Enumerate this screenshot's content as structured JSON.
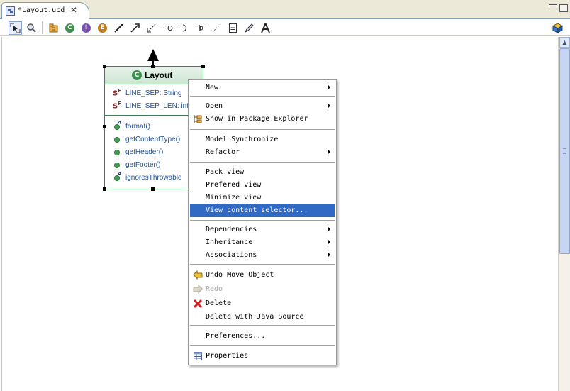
{
  "tab": {
    "title": "*Layout.ucd",
    "close": "✕"
  },
  "toolbar": {
    "tools": [
      "select-tool",
      "zoom-tool",
      "package-tool",
      "class-tool",
      "interface-tool",
      "enumeration-tool",
      "note-connection-tool",
      "association-tool",
      "dependency-tool",
      "lollipop-tool",
      "required-interface-tool",
      "provided-interface-tool",
      "note-link-tool",
      "note-tool",
      "pen-tool",
      "text-tool",
      "palette-tool"
    ]
  },
  "uml_class": {
    "name": "Layout",
    "fields": [
      {
        "label": "LINE_SEP: String"
      },
      {
        "label": "LINE_SEP_LEN: int"
      }
    ],
    "methods": [
      {
        "label": "format()",
        "abstract": true
      },
      {
        "label": "getContentType()",
        "abstract": false
      },
      {
        "label": "getHeader()",
        "abstract": false
      },
      {
        "label": "getFooter()",
        "abstract": false
      },
      {
        "label": "ignoresThrowable",
        "abstract": true
      }
    ]
  },
  "context_menu": {
    "items": [
      {
        "label": "New",
        "submenu": true
      },
      {
        "label": "Open",
        "submenu": true
      },
      {
        "label": "Show in Package Explorer",
        "submenu": false
      },
      {
        "label": "Model Synchronize",
        "submenu": false
      },
      {
        "label": "Refactor",
        "submenu": true
      },
      {
        "label": "Pack view",
        "submenu": false
      },
      {
        "label": "Prefered view",
        "submenu": false
      },
      {
        "label": "Minimize view",
        "submenu": false
      },
      {
        "label": "View content selector...",
        "submenu": false,
        "selected": true
      },
      {
        "label": "Dependencies",
        "submenu": true
      },
      {
        "label": "Inheritance",
        "submenu": true
      },
      {
        "label": "Associations",
        "submenu": true
      },
      {
        "label": "Undo Move Object",
        "submenu": false
      },
      {
        "label": "Redo",
        "submenu": false,
        "disabled": true
      },
      {
        "label": "Delete",
        "submenu": false
      },
      {
        "label": "Delete with Java Source",
        "submenu": false
      },
      {
        "label": "Preferences...",
        "submenu": false
      },
      {
        "label": "Properties",
        "submenu": false
      }
    ]
  },
  "colors": {
    "menu_highlight": "#316ac5",
    "uml_border": "#3f7f4f",
    "uml_text": "#205090"
  }
}
